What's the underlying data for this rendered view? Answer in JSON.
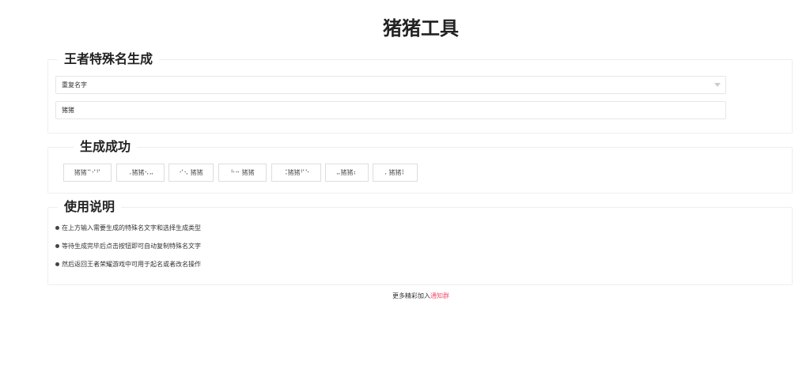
{
  "title": "猪猪工具",
  "generator": {
    "legend": "王者特殊名生成",
    "type_select": "重复名字",
    "name_input": "猪猪"
  },
  "result": {
    "legend": "生成成功",
    "buttons": [
      "猪猪⠉⠊⠋",
      "⠠猪猪⠢⠤",
      "⠊⠢ 猪猪",
      "⠓⠒ 猪猪",
      "⠨猪猪⠋⠑",
      "⠤猪猪⠆",
      "⠄猪猪⠇"
    ]
  },
  "instructions": {
    "legend": "使用说明",
    "items": [
      "在上方输入需要生成的特殊名文字和选择生成类型",
      "等待生成完毕后点击按钮即可自动复制特殊名文字",
      "然后返回王者荣耀游戏中可用于起名或者改名操作"
    ]
  },
  "footer": {
    "text": "更多精彩加入",
    "link": "通知群"
  },
  "colors": {
    "link": "#f0506e"
  }
}
